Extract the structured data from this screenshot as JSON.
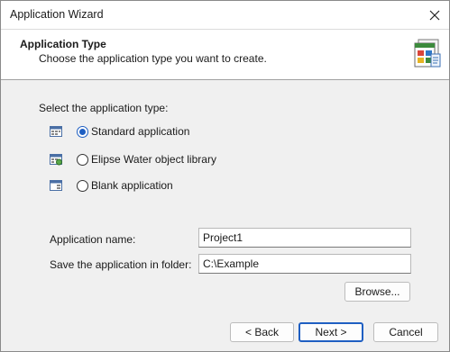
{
  "window": {
    "title": "Application Wizard"
  },
  "header": {
    "title": "Application Type",
    "subtitle": "Choose the application type you want to create."
  },
  "type_section": {
    "label": "Select the application type:",
    "options": [
      {
        "label": "Standard application",
        "selected": true,
        "icon": "standard-app-icon"
      },
      {
        "label": "Elipse Water object library",
        "selected": false,
        "icon": "object-library-icon"
      },
      {
        "label": "Blank application",
        "selected": false,
        "icon": "blank-app-icon"
      }
    ]
  },
  "fields": {
    "app_name": {
      "label": "Application name:",
      "value": "Project1"
    },
    "folder": {
      "label": "Save the application in folder:",
      "value": "C:\\Example"
    }
  },
  "buttons": {
    "browse": "Browse...",
    "back": "< Back",
    "next": "Next >",
    "cancel": "Cancel"
  },
  "colors": {
    "accent": "#1f5fc2",
    "header_bg": "#ffffff",
    "body_bg": "#f0f0f0"
  }
}
